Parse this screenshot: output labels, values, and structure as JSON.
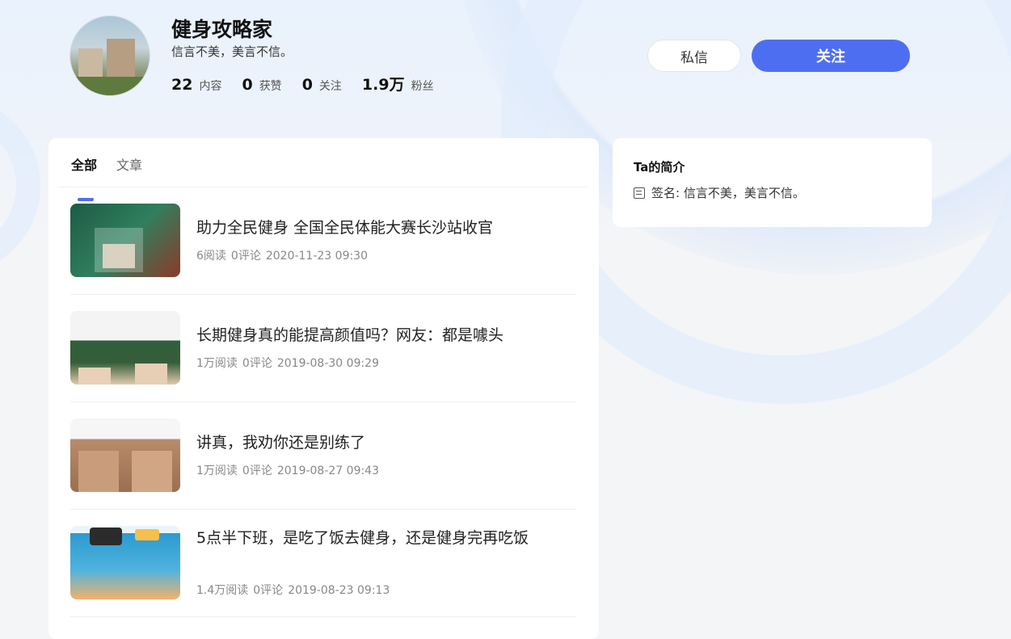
{
  "profile": {
    "name": "健身攻略家",
    "signature": "信言不美，美言不信。",
    "stats": [
      {
        "num": "22",
        "label": "内容"
      },
      {
        "num": "0",
        "label": "获赞"
      },
      {
        "num": "0",
        "label": "关注"
      },
      {
        "num": "1.9万",
        "label": "粉丝"
      }
    ],
    "message_label": "私信",
    "follow_label": "关注"
  },
  "tabs": [
    {
      "label": "全部",
      "active": true
    },
    {
      "label": "文章",
      "active": false
    }
  ],
  "articles": [
    {
      "title": "助力全民健身 全国全民体能大赛长沙站收官",
      "reads": "6阅读",
      "comments": "0评论",
      "date": "2020-11-23 09:30"
    },
    {
      "title": "长期健身真的能提高颜值吗？网友：都是噱头",
      "reads": "1万阅读",
      "comments": "0评论",
      "date": "2019-08-30 09:29"
    },
    {
      "title": "讲真，我劝你还是别练了",
      "reads": "1万阅读",
      "comments": "0评论",
      "date": "2019-08-27 09:43"
    },
    {
      "title": "5点半下班，是吃了饭去健身，还是健身完再吃饭",
      "reads": "1.4万阅读",
      "comments": "0评论",
      "date": "2019-08-23 09:13"
    }
  ],
  "intro": {
    "title": "Ta的简介",
    "signature_label": "签名: 信言不美，美言不信。"
  }
}
